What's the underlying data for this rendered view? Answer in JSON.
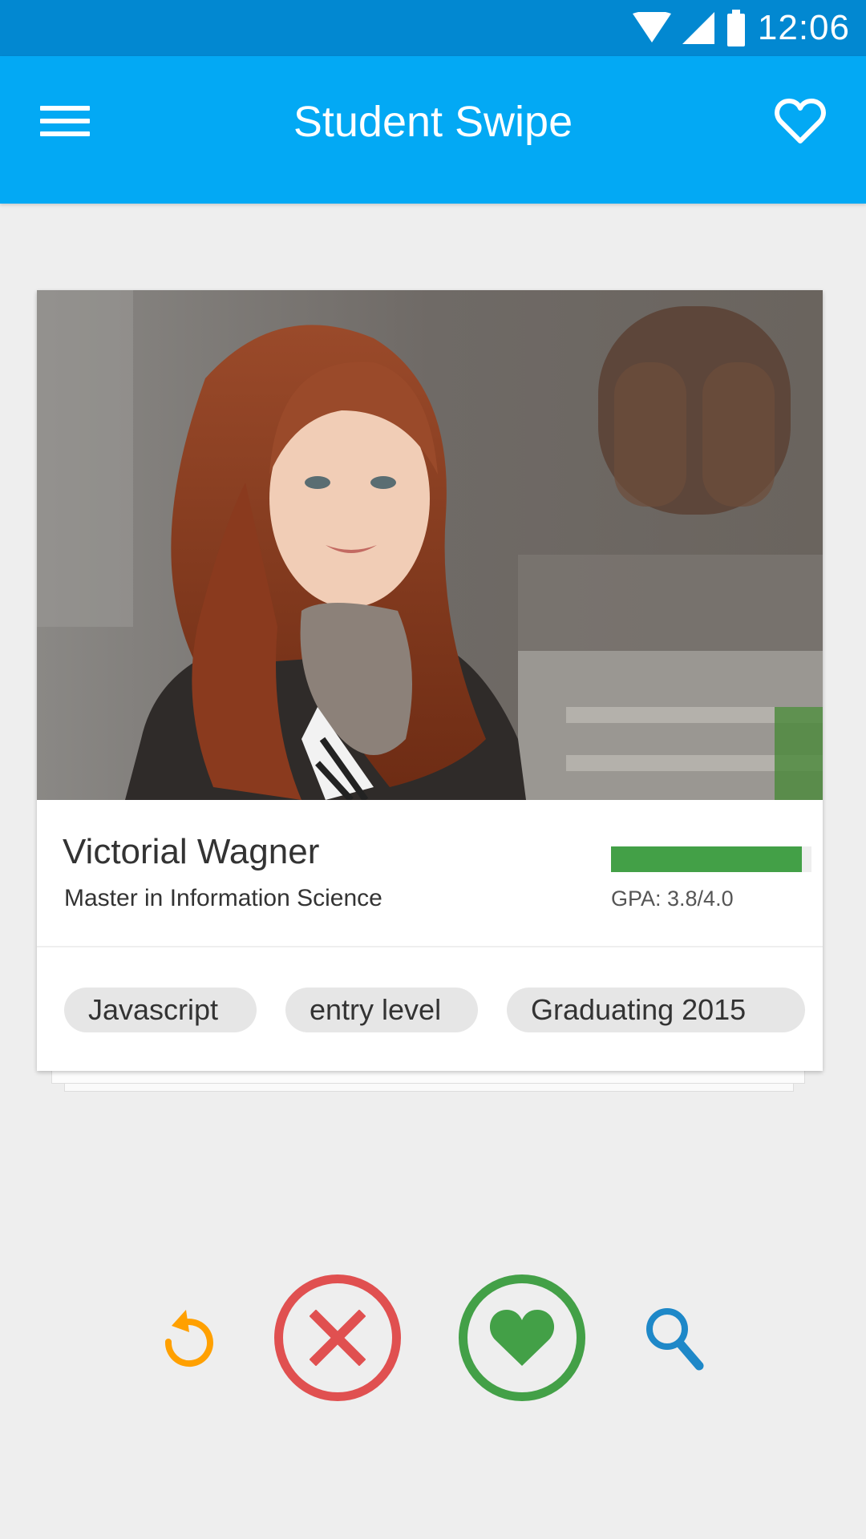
{
  "status_bar": {
    "time": "12:06",
    "icons": [
      "wifi-icon",
      "signal-icon",
      "battery-icon"
    ]
  },
  "app_bar": {
    "title": "Student Swipe",
    "menu_icon": "menu-icon",
    "favorites_icon": "heart-outline-icon"
  },
  "card": {
    "name": "Victorial Wagner",
    "degree": "Master in Information Science",
    "gpa_label": "GPA: 3.8/4.0",
    "gpa_fraction": 0.95,
    "tags": [
      "Javascript",
      "entry level",
      "Graduating 2015"
    ]
  },
  "actions": {
    "undo_icon": "undo-icon",
    "reject_icon": "close-icon",
    "like_icon": "heart-icon",
    "search_icon": "search-icon"
  },
  "colors": {
    "status_bar": "#0288d1",
    "app_bar": "#03a9f4",
    "background": "#eeeeee",
    "gpa_fill": "#43a047",
    "reject": "#e05050",
    "like": "#43a047",
    "undo": "#ffa000",
    "search": "#1e88c8"
  }
}
